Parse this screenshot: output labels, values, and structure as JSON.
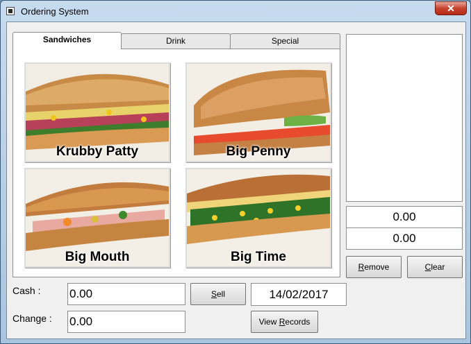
{
  "window": {
    "title": "Ordering System",
    "close_label": "✕"
  },
  "tabs": [
    {
      "label": "Sandwiches",
      "active": true
    },
    {
      "label": "Drink",
      "active": false
    },
    {
      "label": "Special",
      "active": false
    }
  ],
  "products": [
    {
      "name": "Krubby Patty"
    },
    {
      "name": "Big Penny"
    },
    {
      "name": "Big Mouth"
    },
    {
      "name": "Big Time"
    }
  ],
  "order_summary": {
    "total": "0.00",
    "second_total": "0.00"
  },
  "buttons": {
    "remove_first": "R",
    "remove_rest": "emove",
    "clear_first": "C",
    "clear_rest": "lear",
    "sell_first": "S",
    "sell_rest": "ell",
    "view_records_pre": "View ",
    "view_records_first": "R",
    "view_records_rest": "ecords"
  },
  "form": {
    "cash_label": "Cash :",
    "cash_value": "0.00",
    "change_label": "Change :",
    "change_value": "0.00",
    "date": "14/02/2017"
  },
  "colors": {
    "title_close": "#c7432f",
    "window_frame": "#a9c4de"
  },
  "icons": [
    "app-icon",
    "close-icon"
  ]
}
